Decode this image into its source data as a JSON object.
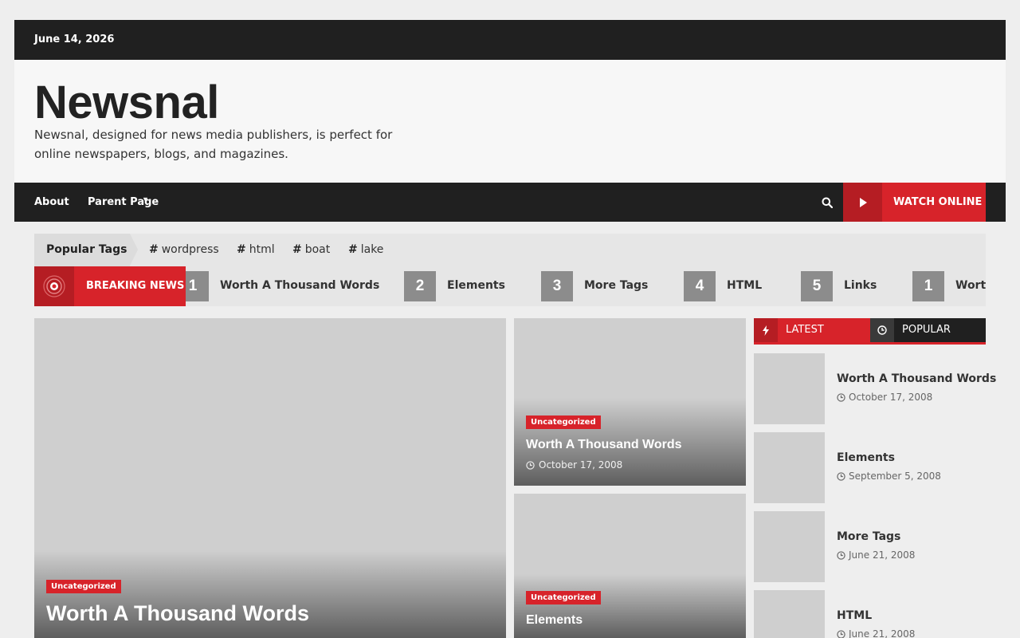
{
  "topbar": {
    "date": "June 14, 2026"
  },
  "site": {
    "title": "Newsnal",
    "description": "Newsnal, designed for news media publishers, is perfect for online newspapers, blogs, and magazines."
  },
  "nav": {
    "items": [
      {
        "label": "About"
      },
      {
        "label": "Parent Page"
      }
    ],
    "watch_label": "WATCH ONLINE"
  },
  "popular_tags": {
    "title": "Popular Tags",
    "tags": [
      "wordpress",
      "html",
      "boat",
      "lake"
    ]
  },
  "breaking": {
    "label": "BREAKING NEWS",
    "items": [
      {
        "num": "1",
        "title": "Worth A Thousand Words"
      },
      {
        "num": "2",
        "title": "Elements"
      },
      {
        "num": "3",
        "title": "More Tags"
      },
      {
        "num": "4",
        "title": "HTML"
      },
      {
        "num": "5",
        "title": "Links"
      },
      {
        "num": "1",
        "title": "Worth A Thousand Words"
      }
    ]
  },
  "featured": {
    "main": {
      "category": "Uncategorized",
      "title": "Worth A Thousand Words"
    },
    "side": [
      {
        "category": "Uncategorized",
        "title": "Worth A Thousand Words",
        "date": "October 17, 2008"
      },
      {
        "category": "Uncategorized",
        "title": "Elements"
      }
    ]
  },
  "sidebar": {
    "tabs": [
      {
        "label": "LATEST"
      },
      {
        "label": "POPULAR"
      }
    ],
    "posts": [
      {
        "title": "Worth A Thousand Words",
        "date": "October 17, 2008"
      },
      {
        "title": "Elements",
        "date": "September 5, 2008"
      },
      {
        "title": "More Tags",
        "date": "June 21, 2008"
      },
      {
        "title": "HTML",
        "date": "June 21, 2008"
      }
    ]
  },
  "colors": {
    "accent": "#d7232a",
    "dark": "#202020"
  }
}
